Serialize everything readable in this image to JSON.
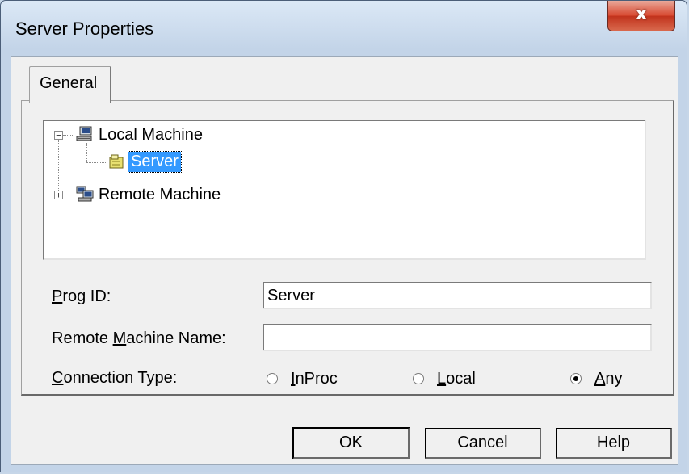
{
  "window": {
    "title": "Server Properties",
    "close_glyph": "x"
  },
  "tabs": [
    {
      "label": "General"
    }
  ],
  "tree": {
    "nodes": [
      {
        "label": "Local Machine",
        "expander": "−",
        "icon": "computer-icon"
      },
      {
        "label": "Server",
        "icon": "server-object-icon",
        "selected": true
      },
      {
        "label": "Remote Machine",
        "expander": "+",
        "icon": "network-computer-icon"
      }
    ]
  },
  "form": {
    "prog_id": {
      "label_underlined": "P",
      "label_rest": "rog ID:",
      "value": "Server"
    },
    "remote_name": {
      "label_pre": "Remote ",
      "label_underlined": "M",
      "label_rest": "achine Name:",
      "value": ""
    },
    "connection_type": {
      "label_underlined": "C",
      "label_rest": "onnection Type:",
      "options": [
        {
          "underlined": "I",
          "rest": "nProc",
          "checked": false
        },
        {
          "underlined": "L",
          "rest": "ocal",
          "checked": false
        },
        {
          "underlined": "A",
          "rest": "ny",
          "checked": true
        }
      ]
    }
  },
  "buttons": {
    "ok": "OK",
    "cancel": "Cancel",
    "help": "Help"
  },
  "colors": {
    "selection": "#3399ff",
    "close_button": "#d7472f"
  }
}
